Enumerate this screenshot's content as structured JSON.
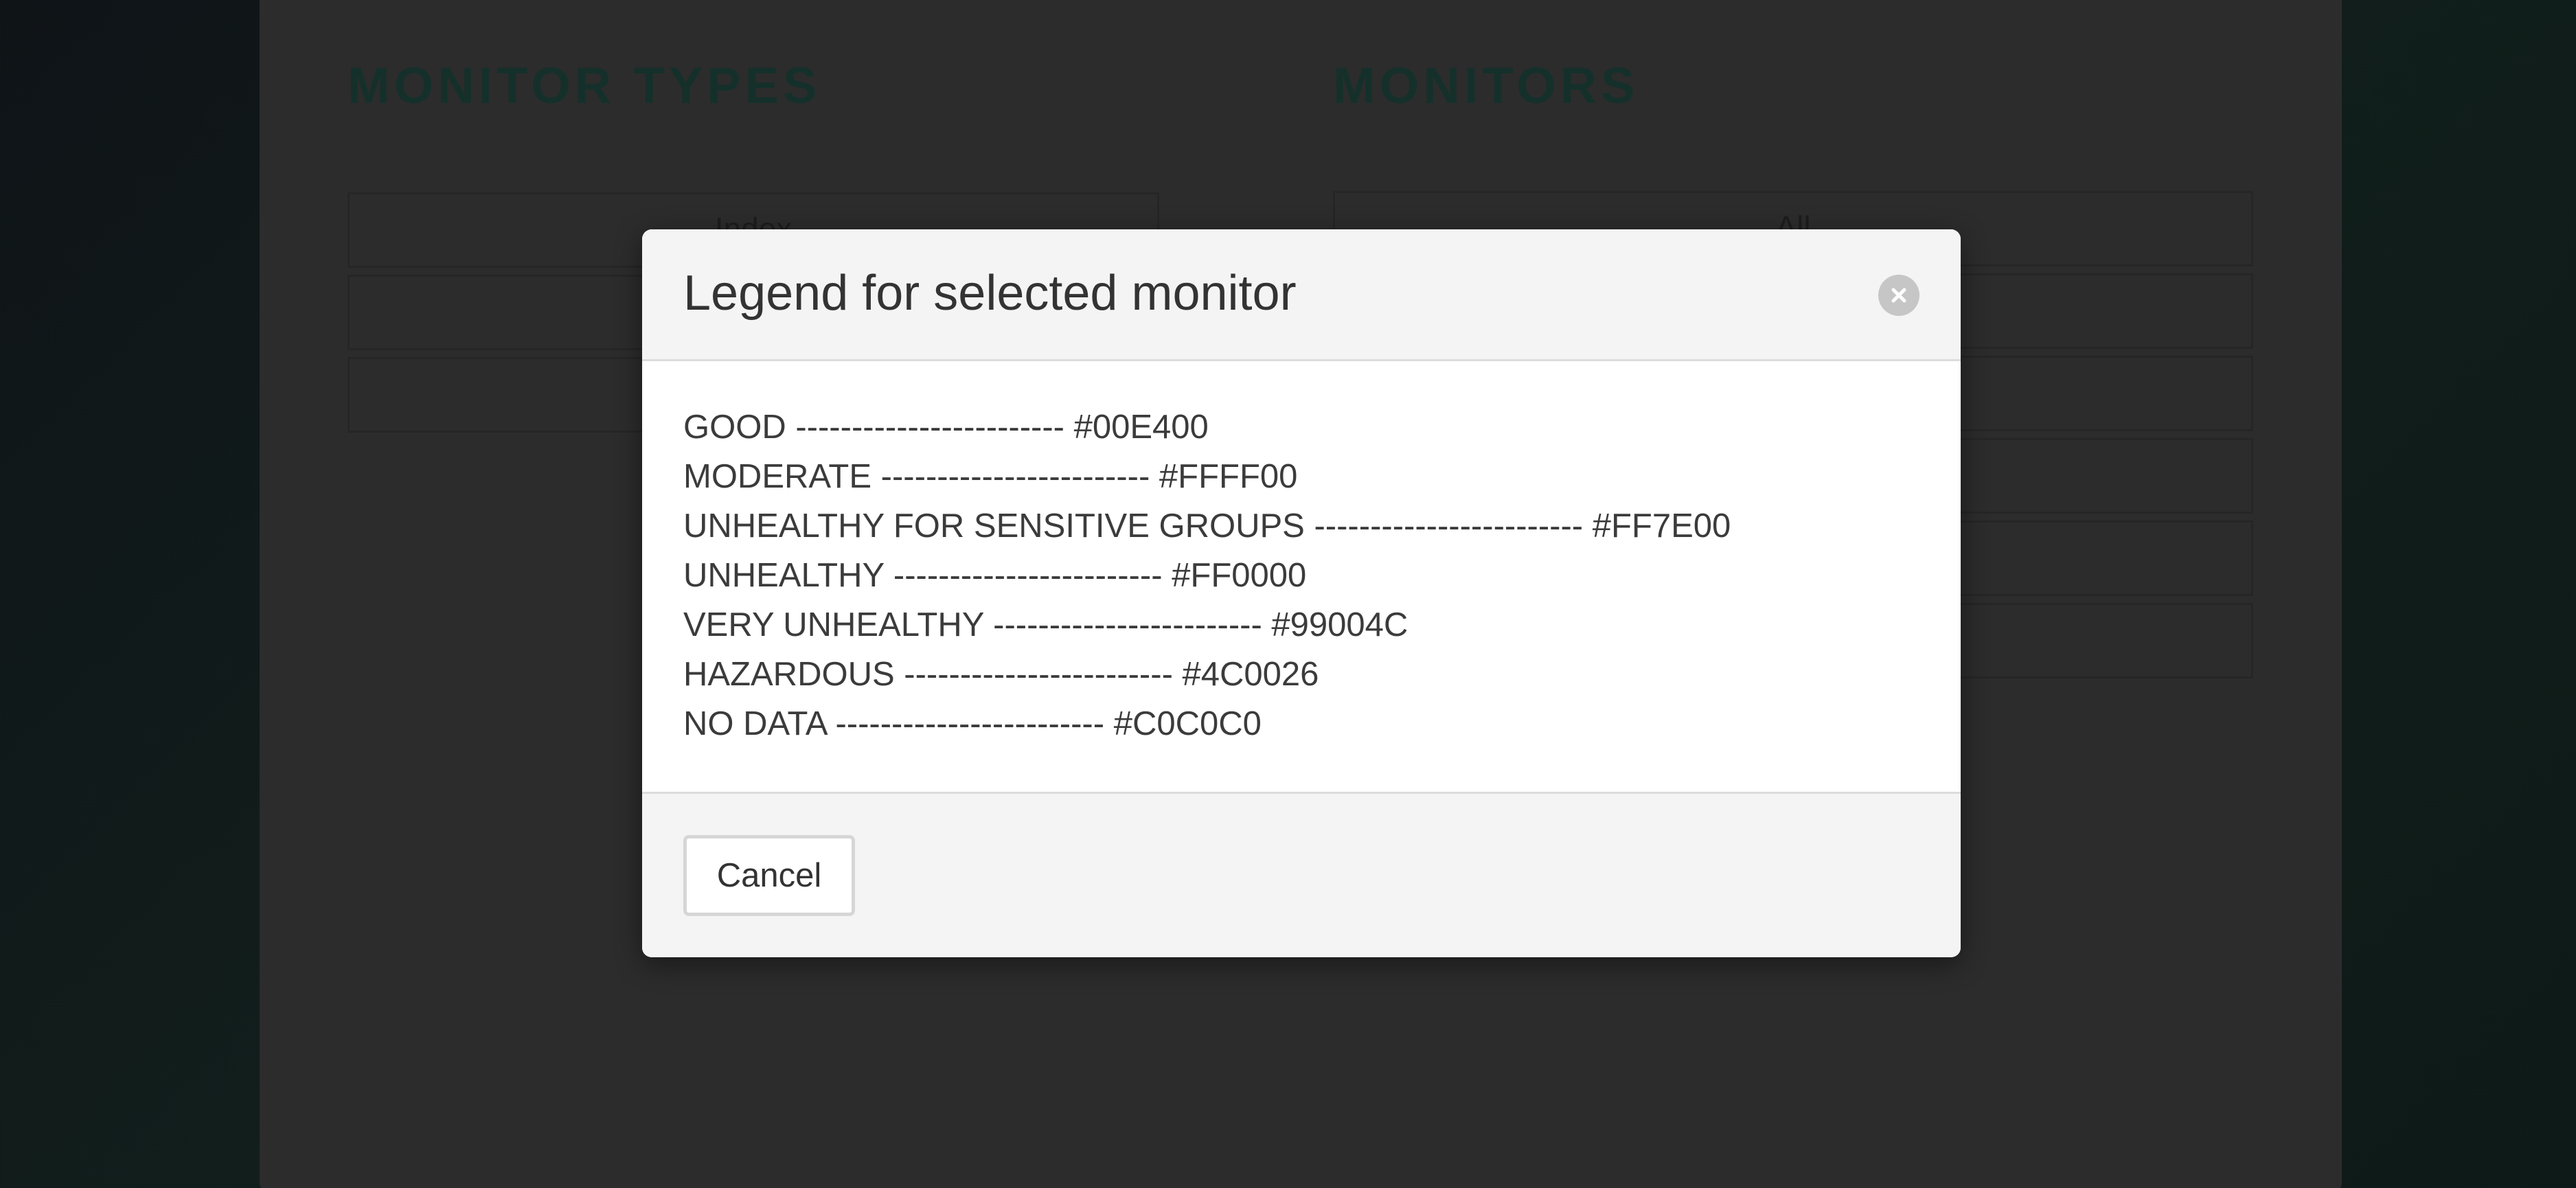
{
  "background": {
    "monitor_types": {
      "title": "MONITOR TYPES",
      "items": [
        "Index",
        "",
        ""
      ]
    },
    "monitors": {
      "title": "MONITORS",
      "items": [
        "All",
        "",
        "",
        "",
        "",
        ""
      ]
    }
  },
  "modal": {
    "title": "Legend for selected monitor",
    "close_icon": "close-icon",
    "legend": [
      {
        "label": "GOOD",
        "separator": "------------------------",
        "color": "#00E400"
      },
      {
        "label": "MODERATE",
        "separator": "------------------------",
        "color": "#FFFF00"
      },
      {
        "label": "UNHEALTHY FOR SENSITIVE GROUPS",
        "separator": "------------------------",
        "color": "#FF7E00"
      },
      {
        "label": "UNHEALTHY",
        "separator": "------------------------",
        "color": "#FF0000"
      },
      {
        "label": "VERY UNHEALTHY",
        "separator": "------------------------",
        "color": "#99004C"
      },
      {
        "label": "HAZARDOUS",
        "separator": "------------------------",
        "color": "#4C0026"
      },
      {
        "label": "NO DATA",
        "separator": "------------------------",
        "color": "#C0C0C0"
      }
    ],
    "cancel_label": "Cancel"
  }
}
